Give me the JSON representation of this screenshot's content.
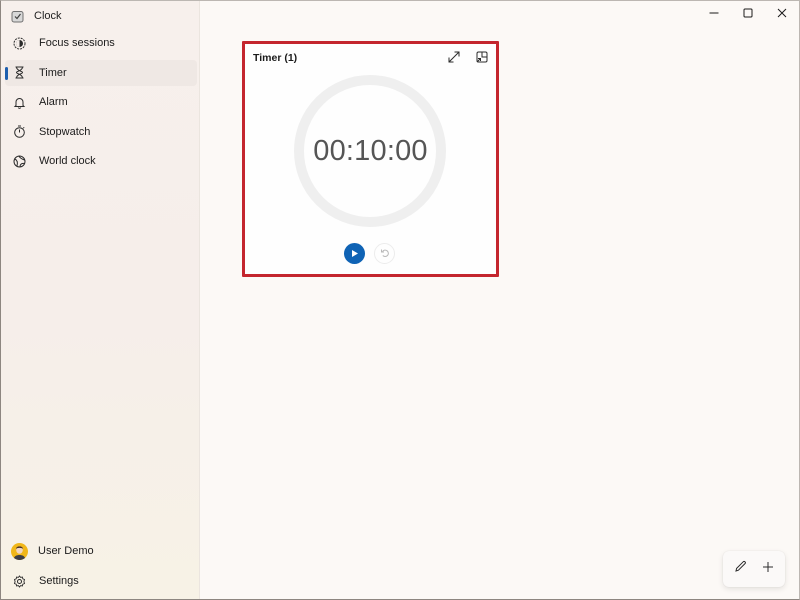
{
  "app": {
    "title": "Clock"
  },
  "window_controls": {
    "minimize_icon": "minimize-icon",
    "maximize_icon": "maximize-icon",
    "close_icon": "close-icon"
  },
  "sidebar": {
    "items": [
      {
        "label": "Focus sessions",
        "icon": "focus-icon",
        "active": false
      },
      {
        "label": "Timer",
        "icon": "hourglass-icon",
        "active": true
      },
      {
        "label": "Alarm",
        "icon": "bell-icon",
        "active": false
      },
      {
        "label": "Stopwatch",
        "icon": "stopwatch-icon",
        "active": false
      },
      {
        "label": "World clock",
        "icon": "globe-icon",
        "active": false
      }
    ],
    "account": {
      "label": "User Demo",
      "icon": "avatar"
    },
    "settings": {
      "label": "Settings",
      "icon": "gear-icon"
    }
  },
  "timer_card": {
    "title": "Timer (1)",
    "time": "00:10:00",
    "progress": 1.0,
    "actions": {
      "expand_icon": "expand-icon",
      "keep_on_top_icon": "keep-on-top-icon",
      "play_icon": "play-icon",
      "reset_icon": "reset-icon"
    },
    "highlight_color": "#c4262e",
    "accent_color": "#0f63b5"
  },
  "footer_actions": {
    "edit_icon": "pencil-icon",
    "add_icon": "plus-icon"
  }
}
